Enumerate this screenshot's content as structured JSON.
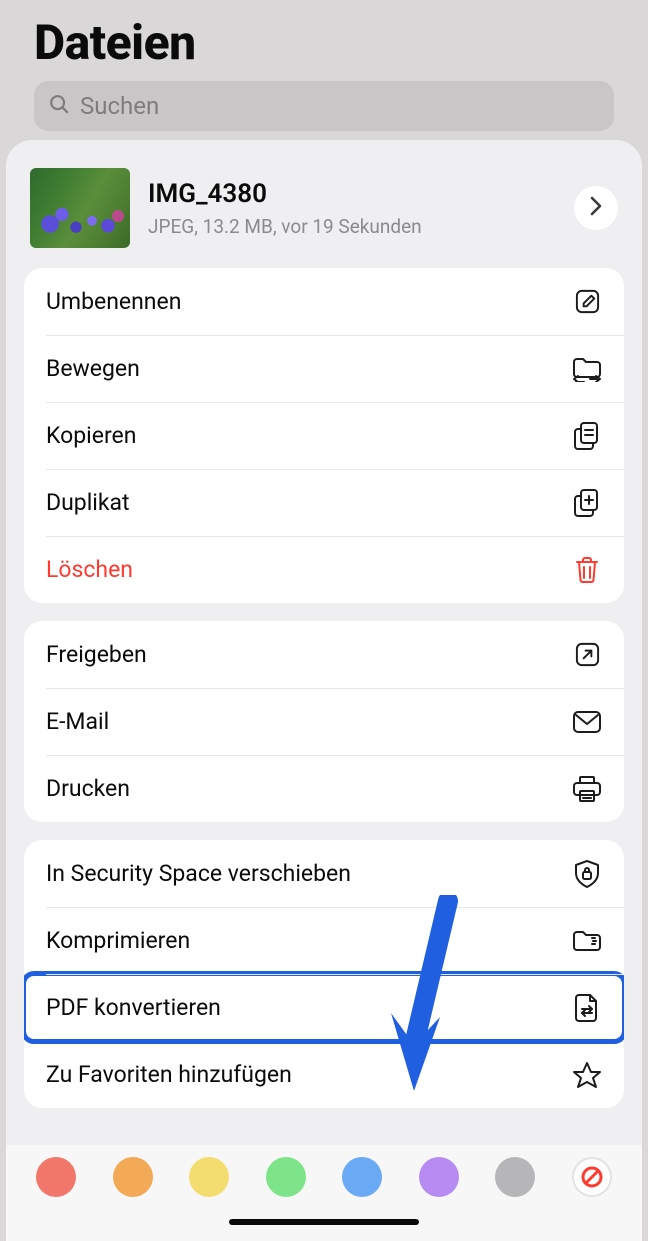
{
  "header": {
    "title": "Dateien"
  },
  "search": {
    "placeholder": "Suchen"
  },
  "file": {
    "name": "IMG_4380",
    "meta": "JPEG, 13.2 MB, vor 19 Sekunden"
  },
  "groups": [
    {
      "items": [
        {
          "label": "Umbenennen",
          "icon": "edit-icon",
          "destructive": false,
          "highlighted": false
        },
        {
          "label": "Bewegen",
          "icon": "move-folder-icon",
          "destructive": false,
          "highlighted": false
        },
        {
          "label": "Kopieren",
          "icon": "copy-doc-icon",
          "destructive": false,
          "highlighted": false
        },
        {
          "label": "Duplikat",
          "icon": "duplicate-doc-icon",
          "destructive": false,
          "highlighted": false
        },
        {
          "label": "Löschen",
          "icon": "trash-icon",
          "destructive": true,
          "highlighted": false
        }
      ]
    },
    {
      "items": [
        {
          "label": "Freigeben",
          "icon": "share-icon",
          "destructive": false,
          "highlighted": false
        },
        {
          "label": "E-Mail",
          "icon": "mail-icon",
          "destructive": false,
          "highlighted": false
        },
        {
          "label": "Drucken",
          "icon": "print-icon",
          "destructive": false,
          "highlighted": false
        }
      ]
    },
    {
      "items": [
        {
          "label": "In Security Space verschieben",
          "icon": "shield-lock-icon",
          "destructive": false,
          "highlighted": false
        },
        {
          "label": "Komprimieren",
          "icon": "zip-icon",
          "destructive": false,
          "highlighted": false
        },
        {
          "label": "PDF konvertieren",
          "icon": "pdf-icon",
          "destructive": false,
          "highlighted": true
        },
        {
          "label": "Zu Favoriten hinzufügen",
          "icon": "star-icon",
          "destructive": false,
          "highlighted": false
        }
      ]
    }
  ],
  "tags": {
    "colors": [
      "#f0776a",
      "#f3aa56",
      "#f3dd6e",
      "#7ee489",
      "#6aa9f4",
      "#b68cf2",
      "#b6b6b9"
    ]
  },
  "annotation": {
    "arrow_color": "#1f5fe0"
  }
}
